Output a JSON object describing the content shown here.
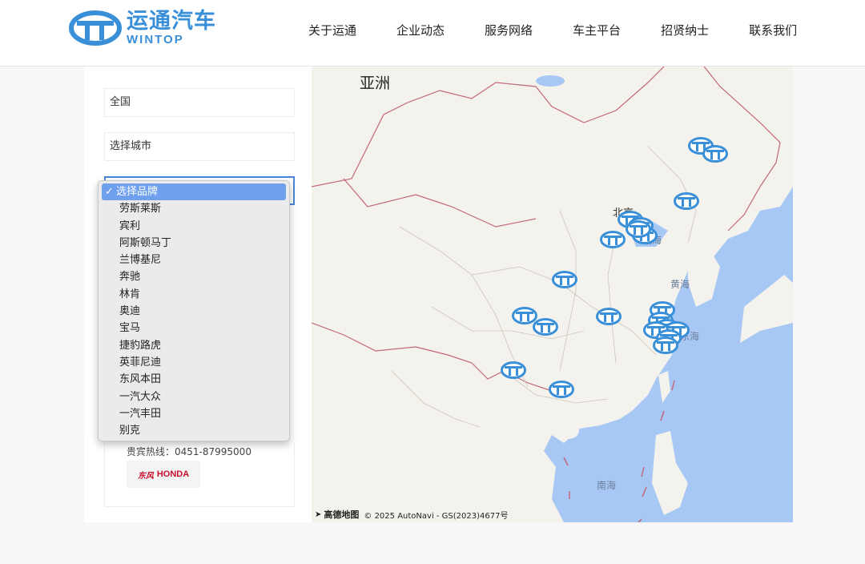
{
  "brand": {
    "name_cn": "运通汽车",
    "name_en": "WINTOP",
    "accent_color": "#3a8fd9"
  },
  "nav": {
    "items": [
      "关于运通",
      "企业动态",
      "服务网络",
      "车主平台",
      "招贤纳士",
      "联系我们"
    ]
  },
  "filters": {
    "region": "全国",
    "city_placeholder": "选择城市",
    "brand_select": {
      "selected": "选择品牌",
      "options": [
        "选择品牌",
        "劳斯莱斯",
        "宾利",
        "阿斯顿马丁",
        "兰博基尼",
        "奔驰",
        "林肯",
        "奥迪",
        "宝马",
        "捷豹路虎",
        "英菲尼迪",
        "东风本田",
        "一汽大众",
        "一汽丰田",
        "别克"
      ]
    }
  },
  "dealer_card": {
    "hotline": "贵宾热线：0451-87995000",
    "brand_logo_script": "东风",
    "brand_logo_word": "HONDA"
  },
  "map": {
    "continent_label": "亚洲",
    "beijing_label": "北京",
    "bohai_label": "渤海",
    "huanghai_label": "黄海",
    "donghai_label": "东海",
    "nanhai_label": "南海",
    "attribution_brand": "高德地图",
    "attribution_text": "© 2025 AutoNavi - GS(2023)4677号",
    "marker_icon": "wintop-logo-icon",
    "land_color": "#f4f2ec",
    "sea_color": "#a7c7f5"
  }
}
